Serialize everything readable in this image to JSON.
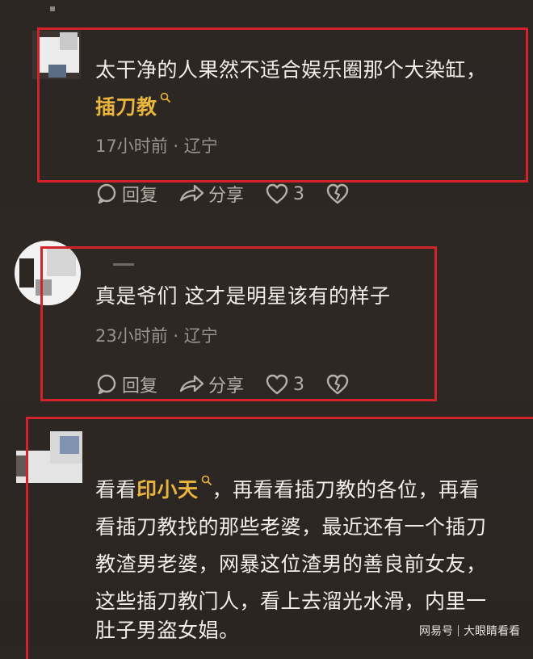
{
  "comments": [
    {
      "text_line1": "太干净的人果然不适合娱乐圈那个大染缸，",
      "link": "插刀教",
      "time_location": "17小时前 · 辽宁",
      "actions": {
        "reply": "回复",
        "share": "分享",
        "likes": "3"
      }
    },
    {
      "text_line1": "真是爷们 这才是明星该有的样子",
      "time_location": "23小时前 · 辽宁",
      "actions": {
        "reply": "回复",
        "share": "分享",
        "likes": "3"
      }
    },
    {
      "text_pre": "看看",
      "link": "印小天",
      "text_post": "，再看看插刀教的各位，再看",
      "line2": "看插刀教找的那些老婆，最近还有一个插刀",
      "line3": "教渣男老婆，网暴这位渣男的善良前女友，",
      "line4": "这些插刀教门人，看上去溜光水滑，内里一",
      "line5": "肚子男盗女娼。"
    }
  ],
  "watermark": {
    "brand": "网易号",
    "account": "大眼睛看看"
  },
  "colors": {
    "background": "#2d2724",
    "highlight_box": "#d2232a",
    "link": "#e9b53d",
    "text": "#f1ede8",
    "meta": "#9b948d"
  },
  "icons": {
    "reply": "comment-bubble-icon",
    "share": "share-arrow-icon",
    "like": "heart-icon",
    "dislike": "broken-heart-icon",
    "search": "search-icon"
  }
}
